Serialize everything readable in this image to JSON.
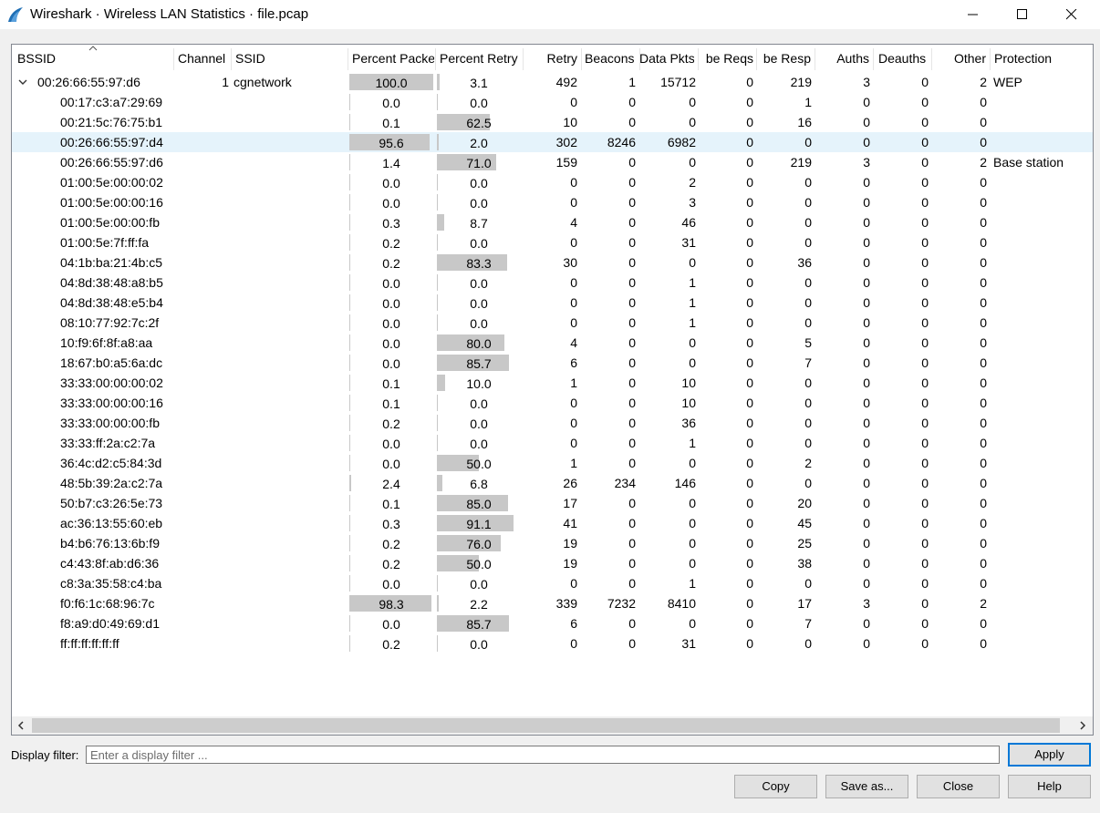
{
  "window": {
    "title": "Wireshark · Wireless LAN Statistics · file.pcap",
    "icon": "wireshark-fin-icon"
  },
  "columns": [
    {
      "key": "bssid",
      "label": "BSSID"
    },
    {
      "key": "channel",
      "label": "Channel"
    },
    {
      "key": "ssid",
      "label": "SSID"
    },
    {
      "key": "pct_packets",
      "label": "Percent Packe"
    },
    {
      "key": "pct_retry",
      "label": "Percent Retry"
    },
    {
      "key": "retry",
      "label": "Retry"
    },
    {
      "key": "beacons",
      "label": "Beacons"
    },
    {
      "key": "data_pkts",
      "label": "Data Pkts"
    },
    {
      "key": "probe_reqs",
      "label": "be Reqs"
    },
    {
      "key": "probe_resp",
      "label": "be Resp"
    },
    {
      "key": "auths",
      "label": "Auths"
    },
    {
      "key": "deauths",
      "label": "Deauths"
    },
    {
      "key": "other",
      "label": "Other"
    },
    {
      "key": "protection",
      "label": "Protection"
    }
  ],
  "parent_row": {
    "bssid": "00:26:66:55:97:d6",
    "channel": "1",
    "ssid": "cgnetwork",
    "pct_packets": "100.0",
    "pct_retry": "3.1",
    "retry": "492",
    "beacons": "1",
    "data_pkts": "15712",
    "probe_reqs": "0",
    "probe_resp": "219",
    "auths": "3",
    "deauths": "0",
    "other": "2",
    "protection": "WEP"
  },
  "rows": [
    {
      "bssid": "00:17:c3:a7:29:69",
      "pct_packets": "0.0",
      "pct_retry": "0.0",
      "retry": "0",
      "beacons": "0",
      "data_pkts": "0",
      "probe_reqs": "0",
      "probe_resp": "1",
      "auths": "0",
      "deauths": "0",
      "other": "0",
      "protection": ""
    },
    {
      "bssid": "00:21:5c:76:75:b1",
      "pct_packets": "0.1",
      "pct_retry": "62.5",
      "retry": "10",
      "beacons": "0",
      "data_pkts": "0",
      "probe_reqs": "0",
      "probe_resp": "16",
      "auths": "0",
      "deauths": "0",
      "other": "0",
      "protection": ""
    },
    {
      "bssid": "00:26:66:55:97:d4",
      "pct_packets": "95.6",
      "pct_retry": "2.0",
      "retry": "302",
      "beacons": "8246",
      "data_pkts": "6982",
      "probe_reqs": "0",
      "probe_resp": "0",
      "auths": "0",
      "deauths": "0",
      "other": "0",
      "protection": "",
      "selected": true
    },
    {
      "bssid": "00:26:66:55:97:d6",
      "pct_packets": "1.4",
      "pct_retry": "71.0",
      "retry": "159",
      "beacons": "0",
      "data_pkts": "0",
      "probe_reqs": "0",
      "probe_resp": "219",
      "auths": "3",
      "deauths": "0",
      "other": "2",
      "protection": "Base station"
    },
    {
      "bssid": "01:00:5e:00:00:02",
      "pct_packets": "0.0",
      "pct_retry": "0.0",
      "retry": "0",
      "beacons": "0",
      "data_pkts": "2",
      "probe_reqs": "0",
      "probe_resp": "0",
      "auths": "0",
      "deauths": "0",
      "other": "0",
      "protection": ""
    },
    {
      "bssid": "01:00:5e:00:00:16",
      "pct_packets": "0.0",
      "pct_retry": "0.0",
      "retry": "0",
      "beacons": "0",
      "data_pkts": "3",
      "probe_reqs": "0",
      "probe_resp": "0",
      "auths": "0",
      "deauths": "0",
      "other": "0",
      "protection": ""
    },
    {
      "bssid": "01:00:5e:00:00:fb",
      "pct_packets": "0.3",
      "pct_retry": "8.7",
      "retry": "4",
      "beacons": "0",
      "data_pkts": "46",
      "probe_reqs": "0",
      "probe_resp": "0",
      "auths": "0",
      "deauths": "0",
      "other": "0",
      "protection": ""
    },
    {
      "bssid": "01:00:5e:7f:ff:fa",
      "pct_packets": "0.2",
      "pct_retry": "0.0",
      "retry": "0",
      "beacons": "0",
      "data_pkts": "31",
      "probe_reqs": "0",
      "probe_resp": "0",
      "auths": "0",
      "deauths": "0",
      "other": "0",
      "protection": ""
    },
    {
      "bssid": "04:1b:ba:21:4b:c5",
      "pct_packets": "0.2",
      "pct_retry": "83.3",
      "retry": "30",
      "beacons": "0",
      "data_pkts": "0",
      "probe_reqs": "0",
      "probe_resp": "36",
      "auths": "0",
      "deauths": "0",
      "other": "0",
      "protection": ""
    },
    {
      "bssid": "04:8d:38:48:a8:b5",
      "pct_packets": "0.0",
      "pct_retry": "0.0",
      "retry": "0",
      "beacons": "0",
      "data_pkts": "1",
      "probe_reqs": "0",
      "probe_resp": "0",
      "auths": "0",
      "deauths": "0",
      "other": "0",
      "protection": ""
    },
    {
      "bssid": "04:8d:38:48:e5:b4",
      "pct_packets": "0.0",
      "pct_retry": "0.0",
      "retry": "0",
      "beacons": "0",
      "data_pkts": "1",
      "probe_reqs": "0",
      "probe_resp": "0",
      "auths": "0",
      "deauths": "0",
      "other": "0",
      "protection": ""
    },
    {
      "bssid": "08:10:77:92:7c:2f",
      "pct_packets": "0.0",
      "pct_retry": "0.0",
      "retry": "0",
      "beacons": "0",
      "data_pkts": "1",
      "probe_reqs": "0",
      "probe_resp": "0",
      "auths": "0",
      "deauths": "0",
      "other": "0",
      "protection": ""
    },
    {
      "bssid": "10:f9:6f:8f:a8:aa",
      "pct_packets": "0.0",
      "pct_retry": "80.0",
      "retry": "4",
      "beacons": "0",
      "data_pkts": "0",
      "probe_reqs": "0",
      "probe_resp": "5",
      "auths": "0",
      "deauths": "0",
      "other": "0",
      "protection": ""
    },
    {
      "bssid": "18:67:b0:a5:6a:dc",
      "pct_packets": "0.0",
      "pct_retry": "85.7",
      "retry": "6",
      "beacons": "0",
      "data_pkts": "0",
      "probe_reqs": "0",
      "probe_resp": "7",
      "auths": "0",
      "deauths": "0",
      "other": "0",
      "protection": ""
    },
    {
      "bssid": "33:33:00:00:00:02",
      "pct_packets": "0.1",
      "pct_retry": "10.0",
      "retry": "1",
      "beacons": "0",
      "data_pkts": "10",
      "probe_reqs": "0",
      "probe_resp": "0",
      "auths": "0",
      "deauths": "0",
      "other": "0",
      "protection": ""
    },
    {
      "bssid": "33:33:00:00:00:16",
      "pct_packets": "0.1",
      "pct_retry": "0.0",
      "retry": "0",
      "beacons": "0",
      "data_pkts": "10",
      "probe_reqs": "0",
      "probe_resp": "0",
      "auths": "0",
      "deauths": "0",
      "other": "0",
      "protection": ""
    },
    {
      "bssid": "33:33:00:00:00:fb",
      "pct_packets": "0.2",
      "pct_retry": "0.0",
      "retry": "0",
      "beacons": "0",
      "data_pkts": "36",
      "probe_reqs": "0",
      "probe_resp": "0",
      "auths": "0",
      "deauths": "0",
      "other": "0",
      "protection": ""
    },
    {
      "bssid": "33:33:ff:2a:c2:7a",
      "pct_packets": "0.0",
      "pct_retry": "0.0",
      "retry": "0",
      "beacons": "0",
      "data_pkts": "1",
      "probe_reqs": "0",
      "probe_resp": "0",
      "auths": "0",
      "deauths": "0",
      "other": "0",
      "protection": ""
    },
    {
      "bssid": "36:4c:d2:c5:84:3d",
      "pct_packets": "0.0",
      "pct_retry": "50.0",
      "retry": "1",
      "beacons": "0",
      "data_pkts": "0",
      "probe_reqs": "0",
      "probe_resp": "2",
      "auths": "0",
      "deauths": "0",
      "other": "0",
      "protection": ""
    },
    {
      "bssid": "48:5b:39:2a:c2:7a",
      "pct_packets": "2.4",
      "pct_retry": "6.8",
      "retry": "26",
      "beacons": "234",
      "data_pkts": "146",
      "probe_reqs": "0",
      "probe_resp": "0",
      "auths": "0",
      "deauths": "0",
      "other": "0",
      "protection": ""
    },
    {
      "bssid": "50:b7:c3:26:5e:73",
      "pct_packets": "0.1",
      "pct_retry": "85.0",
      "retry": "17",
      "beacons": "0",
      "data_pkts": "0",
      "probe_reqs": "0",
      "probe_resp": "20",
      "auths": "0",
      "deauths": "0",
      "other": "0",
      "protection": ""
    },
    {
      "bssid": "ac:36:13:55:60:eb",
      "pct_packets": "0.3",
      "pct_retry": "91.1",
      "retry": "41",
      "beacons": "0",
      "data_pkts": "0",
      "probe_reqs": "0",
      "probe_resp": "45",
      "auths": "0",
      "deauths": "0",
      "other": "0",
      "protection": ""
    },
    {
      "bssid": "b4:b6:76:13:6b:f9",
      "pct_packets": "0.2",
      "pct_retry": "76.0",
      "retry": "19",
      "beacons": "0",
      "data_pkts": "0",
      "probe_reqs": "0",
      "probe_resp": "25",
      "auths": "0",
      "deauths": "0",
      "other": "0",
      "protection": ""
    },
    {
      "bssid": "c4:43:8f:ab:d6:36",
      "pct_packets": "0.2",
      "pct_retry": "50.0",
      "retry": "19",
      "beacons": "0",
      "data_pkts": "0",
      "probe_reqs": "0",
      "probe_resp": "38",
      "auths": "0",
      "deauths": "0",
      "other": "0",
      "protection": ""
    },
    {
      "bssid": "c8:3a:35:58:c4:ba",
      "pct_packets": "0.0",
      "pct_retry": "0.0",
      "retry": "0",
      "beacons": "0",
      "data_pkts": "1",
      "probe_reqs": "0",
      "probe_resp": "0",
      "auths": "0",
      "deauths": "0",
      "other": "0",
      "protection": ""
    },
    {
      "bssid": "f0:f6:1c:68:96:7c",
      "pct_packets": "98.3",
      "pct_retry": "2.2",
      "retry": "339",
      "beacons": "7232",
      "data_pkts": "8410",
      "probe_reqs": "0",
      "probe_resp": "17",
      "auths": "3",
      "deauths": "0",
      "other": "2",
      "protection": ""
    },
    {
      "bssid": "f8:a9:d0:49:69:d1",
      "pct_packets": "0.0",
      "pct_retry": "85.7",
      "retry": "6",
      "beacons": "0",
      "data_pkts": "0",
      "probe_reqs": "0",
      "probe_resp": "7",
      "auths": "0",
      "deauths": "0",
      "other": "0",
      "protection": ""
    },
    {
      "bssid": "ff:ff:ff:ff:ff:ff",
      "pct_packets": "0.2",
      "pct_retry": "0.0",
      "retry": "0",
      "beacons": "0",
      "data_pkts": "31",
      "probe_reqs": "0",
      "probe_resp": "0",
      "auths": "0",
      "deauths": "0",
      "other": "0",
      "protection": ""
    }
  ],
  "filter": {
    "label": "Display filter:",
    "placeholder": "Enter a display filter ..."
  },
  "buttons": {
    "apply": "Apply",
    "copy": "Copy",
    "save_as": "Save as...",
    "close": "Close",
    "help": "Help"
  },
  "colors": {
    "selected_row": "#e5f3fb",
    "percent_bar": "#c8c8c8",
    "default_button_border": "#0078d7"
  }
}
